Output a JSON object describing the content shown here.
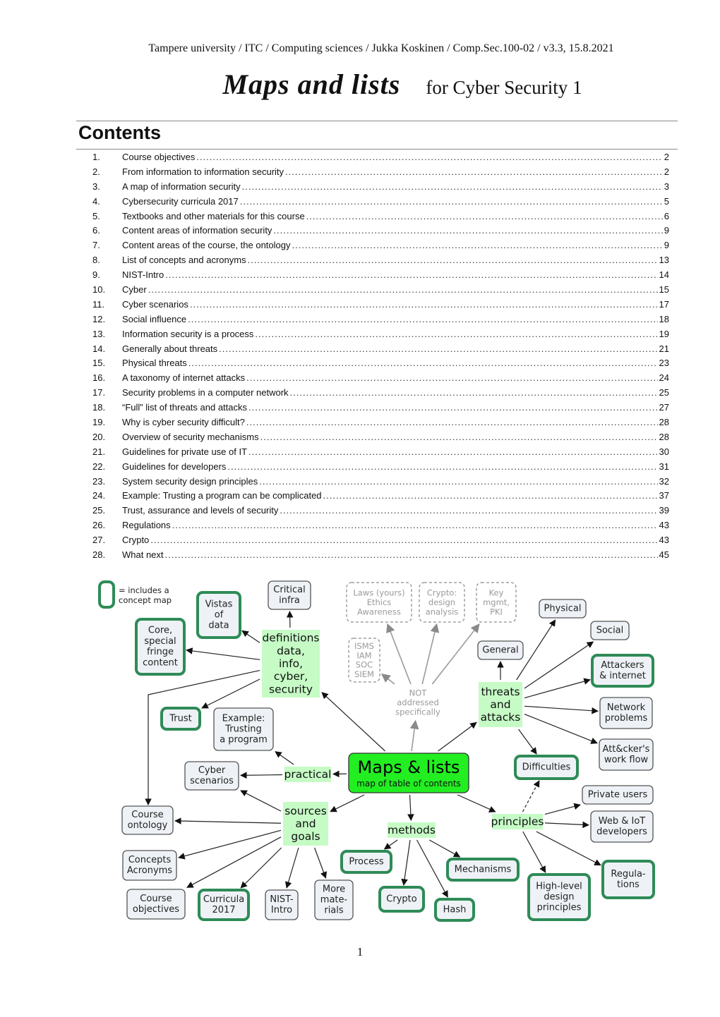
{
  "header": {
    "running_head": "Tampere university / ITC / Computing sciences  / Jukka Koskinen /  Comp.Sec.100-02   / v3.3, 15.8.2021",
    "title": "Maps and lists",
    "subtitle": "for Cyber Security 1"
  },
  "contents": {
    "heading": "Contents",
    "items": [
      {
        "num": "1.",
        "label": "Course objectives",
        "page": "2"
      },
      {
        "num": "2.",
        "label": "From information to information security",
        "page": "2"
      },
      {
        "num": "3.",
        "label": "A map of information security",
        "page": "3"
      },
      {
        "num": "4.",
        "label": "Cybersecurity curricula 2017",
        "page": "5"
      },
      {
        "num": "5.",
        "label": "Textbooks and other materials for this course",
        "page": "6"
      },
      {
        "num": "6.",
        "label": "Content areas of information security",
        "page": "9"
      },
      {
        "num": "7.",
        "label": "Content areas of the course, the ontology",
        "page": "9"
      },
      {
        "num": "8.",
        "label": "List of concepts and acronyms",
        "page": "13"
      },
      {
        "num": "9.",
        "label": "NIST-Intro",
        "page": "14"
      },
      {
        "num": "10.",
        "label": "Cyber",
        "page": "15"
      },
      {
        "num": "11.",
        "label": "Cyber scenarios",
        "page": "17"
      },
      {
        "num": "12.",
        "label": "Social influence",
        "page": "18"
      },
      {
        "num": "13.",
        "label": "Information security is a process",
        "page": "19"
      },
      {
        "num": "14.",
        "label": "Generally about threats",
        "page": "21"
      },
      {
        "num": "15.",
        "label": "Physical threats",
        "page": "23"
      },
      {
        "num": "16.",
        "label": "A taxonomy of internet attacks",
        "page": "24"
      },
      {
        "num": "17.",
        "label": "Security problems in a computer network",
        "page": "25"
      },
      {
        "num": "18.",
        "label": "“Full” list of threats and attacks",
        "page": "27"
      },
      {
        "num": "19.",
        "label": "Why is cyber security difficult?",
        "page": "28"
      },
      {
        "num": "20.",
        "label": "Overview of security mechanisms",
        "page": "28"
      },
      {
        "num": "21.",
        "label": "Guidelines for private use of IT",
        "page": "30"
      },
      {
        "num": "22.",
        "label": "Guidelines for developers",
        "page": "31"
      },
      {
        "num": "23.",
        "label": "System security design principles",
        "page": "32"
      },
      {
        "num": "24.",
        "label": "Example: Trusting a program can be complicated",
        "page": "37"
      },
      {
        "num": "25.",
        "label": "Trust, assurance and levels of security",
        "page": "39"
      },
      {
        "num": "26.",
        "label": "Regulations",
        "page": "43"
      },
      {
        "num": "27.",
        "label": "Crypto",
        "page": "43"
      },
      {
        "num": "28.",
        "label": "What next",
        "page": "45"
      }
    ]
  },
  "concept_map": {
    "colors": {
      "node_fill": "#eef2f6",
      "node_border": "#555555",
      "concept_map_border": "#2e8b57",
      "category_fill": "#c6fbc6",
      "root_fill": "#22ee22",
      "dashed_gray": "#a0a0a0",
      "edge": "#222222"
    },
    "legend": "= includes a concept map",
    "root": {
      "id": "root",
      "title": "Maps & lists",
      "subtitle": "map of table of contents"
    },
    "categories": [
      {
        "id": "definitions",
        "lines": [
          "definitions",
          "data,",
          "info,",
          "cyber,",
          "security"
        ]
      },
      {
        "id": "threats",
        "lines": [
          "threats",
          "and",
          "attacks"
        ]
      },
      {
        "id": "practical",
        "lines": [
          "practical"
        ]
      },
      {
        "id": "sources",
        "lines": [
          "sources",
          "and",
          "goals"
        ]
      },
      {
        "id": "methods",
        "lines": [
          "methods"
        ]
      },
      {
        "id": "principles",
        "lines": [
          "principles"
        ]
      },
      {
        "id": "not_addressed",
        "lines": [
          "NOT",
          "addressed",
          "specifically"
        ]
      }
    ],
    "nodes": [
      {
        "id": "critical",
        "lines": [
          "Critical",
          "infra"
        ],
        "style": "plain"
      },
      {
        "id": "vistas",
        "lines": [
          "Vistas",
          "of",
          "data"
        ],
        "style": "map"
      },
      {
        "id": "core",
        "lines": [
          "Core,",
          "special",
          "fringe",
          "content"
        ],
        "style": "map"
      },
      {
        "id": "laws",
        "lines": [
          "Laws (yours)",
          "Ethics",
          "Awareness"
        ],
        "style": "dashed"
      },
      {
        "id": "cryptoda",
        "lines": [
          "Crypto:",
          "design",
          "analysis"
        ],
        "style": "dashed"
      },
      {
        "id": "keymgmt",
        "lines": [
          "Key",
          "mgmt,",
          "PKI"
        ],
        "style": "dashed"
      },
      {
        "id": "isms",
        "lines": [
          "ISMS",
          "IAM",
          "SOC",
          "SIEM"
        ],
        "style": "dashed"
      },
      {
        "id": "physical",
        "lines": [
          "Physical"
        ],
        "style": "plain"
      },
      {
        "id": "social",
        "lines": [
          "Social"
        ],
        "style": "plain"
      },
      {
        "id": "general",
        "lines": [
          "General"
        ],
        "style": "plain"
      },
      {
        "id": "attackers",
        "lines": [
          "Attackers",
          "& internet"
        ],
        "style": "map"
      },
      {
        "id": "network",
        "lines": [
          "Network",
          "problems"
        ],
        "style": "plain"
      },
      {
        "id": "workflow",
        "lines": [
          "Att&cker's",
          "work flow"
        ],
        "style": "plain"
      },
      {
        "id": "difficulties",
        "lines": [
          "Difficulties"
        ],
        "style": "map"
      },
      {
        "id": "trust",
        "lines": [
          "Trust"
        ],
        "style": "map"
      },
      {
        "id": "example",
        "lines": [
          "Example:",
          "Trusting",
          "a program"
        ],
        "style": "plain"
      },
      {
        "id": "scenarios",
        "lines": [
          "Cyber",
          "scenarios"
        ],
        "style": "plain"
      },
      {
        "id": "ontology",
        "lines": [
          "Course",
          "ontology"
        ],
        "style": "plain"
      },
      {
        "id": "concepts",
        "lines": [
          "Concepts",
          "Acronyms"
        ],
        "style": "plain"
      },
      {
        "id": "objectives",
        "lines": [
          "Course",
          "objectives"
        ],
        "style": "plain"
      },
      {
        "id": "curricula",
        "lines": [
          "Curricula",
          "2017"
        ],
        "style": "map"
      },
      {
        "id": "nist",
        "lines": [
          "NIST-",
          "Intro"
        ],
        "style": "plain"
      },
      {
        "id": "more",
        "lines": [
          "More",
          "mate-",
          "rials"
        ],
        "style": "plain"
      },
      {
        "id": "process",
        "lines": [
          "Process"
        ],
        "style": "map"
      },
      {
        "id": "crypto",
        "lines": [
          "Crypto"
        ],
        "style": "map"
      },
      {
        "id": "hash",
        "lines": [
          "Hash"
        ],
        "style": "map"
      },
      {
        "id": "mechanisms",
        "lines": [
          "Mechanisms"
        ],
        "style": "map"
      },
      {
        "id": "private",
        "lines": [
          "Private users"
        ],
        "style": "plain"
      },
      {
        "id": "webiot",
        "lines": [
          "Web & IoT",
          "developers"
        ],
        "style": "plain"
      },
      {
        "id": "regulations",
        "lines": [
          "Regula-",
          "tions"
        ],
        "style": "map"
      },
      {
        "id": "highlevel",
        "lines": [
          "High-level",
          "design",
          "principles"
        ],
        "style": "map"
      }
    ],
    "edges": [
      {
        "from": "root",
        "to": "definitions"
      },
      {
        "from": "root",
        "to": "threats"
      },
      {
        "from": "root",
        "to": "practical"
      },
      {
        "from": "root",
        "to": "sources"
      },
      {
        "from": "root",
        "to": "methods"
      },
      {
        "from": "root",
        "to": "principles"
      },
      {
        "from": "root",
        "to": "not_addressed",
        "kind": "gray"
      },
      {
        "from": "not_addressed",
        "to": "laws",
        "kind": "gray"
      },
      {
        "from": "not_addressed",
        "to": "cryptoda",
        "kind": "gray"
      },
      {
        "from": "not_addressed",
        "to": "keymgmt",
        "kind": "gray"
      },
      {
        "from": "not_addressed",
        "to": "isms",
        "kind": "gray"
      },
      {
        "from": "definitions",
        "to": "critical"
      },
      {
        "from": "definitions",
        "to": "vistas"
      },
      {
        "from": "definitions",
        "to": "core"
      },
      {
        "from": "definitions",
        "to": "trust"
      },
      {
        "from": "definitions",
        "to": "ontology",
        "kind": "elbow"
      },
      {
        "from": "threats",
        "to": "general"
      },
      {
        "from": "threats",
        "to": "physical"
      },
      {
        "from": "threats",
        "to": "social"
      },
      {
        "from": "threats",
        "to": "attackers"
      },
      {
        "from": "threats",
        "to": "network"
      },
      {
        "from": "threats",
        "to": "workflow"
      },
      {
        "from": "threats",
        "to": "difficulties"
      },
      {
        "from": "principles",
        "to": "difficulties",
        "kind": "dashed"
      },
      {
        "from": "practical",
        "to": "example"
      },
      {
        "from": "practical",
        "to": "scenarios"
      },
      {
        "from": "sources",
        "to": "scenarios"
      },
      {
        "from": "sources",
        "to": "ontology"
      },
      {
        "from": "sources",
        "to": "concepts"
      },
      {
        "from": "sources",
        "to": "objectives"
      },
      {
        "from": "sources",
        "to": "curricula"
      },
      {
        "from": "sources",
        "to": "nist"
      },
      {
        "from": "sources",
        "to": "more"
      },
      {
        "from": "methods",
        "to": "process"
      },
      {
        "from": "methods",
        "to": "crypto"
      },
      {
        "from": "methods",
        "to": "hash"
      },
      {
        "from": "methods",
        "to": "mechanisms"
      },
      {
        "from": "principles",
        "to": "private"
      },
      {
        "from": "principles",
        "to": "webiot"
      },
      {
        "from": "principles",
        "to": "regulations"
      },
      {
        "from": "principles",
        "to": "highlevel"
      }
    ]
  },
  "footer": {
    "page_number": "1"
  }
}
